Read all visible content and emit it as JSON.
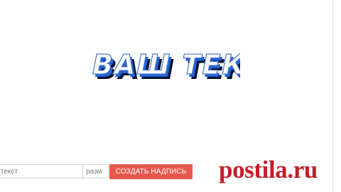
{
  "preview": {
    "stylized_text": "ВАШ ТЕКСТ",
    "colors": {
      "fill": "#ffffff",
      "blue_shadow": "#1f62d6",
      "dark_shadow": "#090f2f"
    }
  },
  "form": {
    "text_placeholder": "текст",
    "size_placeholder": "разм",
    "create_button_label": "СОЗДАТЬ НАДПИСЬ"
  },
  "watermark": {
    "text": "postila.ru",
    "color": "#c31f2a"
  }
}
